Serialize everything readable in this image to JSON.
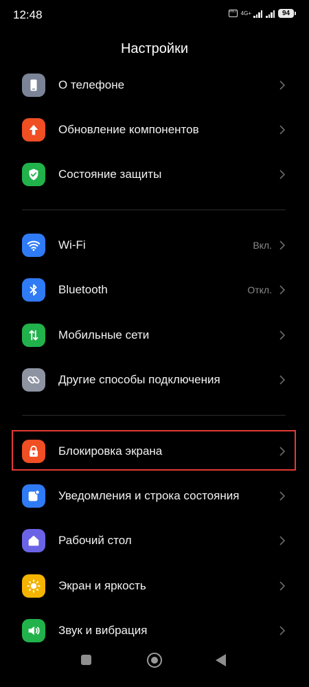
{
  "status_bar": {
    "time": "12:48",
    "volte_label": "VoLTE",
    "network_type": "4G+",
    "battery": "94"
  },
  "header": {
    "title": "Настройки"
  },
  "sections": [
    {
      "items": [
        {
          "label": "О телефоне",
          "value": "",
          "icon": "phone-icon",
          "icon_color": "#7b8497"
        },
        {
          "label": "Обновление компонентов",
          "value": "",
          "icon": "arrow-up-icon",
          "icon_color": "#f04e23"
        },
        {
          "label": "Состояние защиты",
          "value": "",
          "icon": "shield-check-icon",
          "icon_color": "#21b24b"
        }
      ]
    },
    {
      "items": [
        {
          "label": "Wi-Fi",
          "value": "Вкл.",
          "icon": "wifi-icon",
          "icon_color": "#2f7bf6"
        },
        {
          "label": "Bluetooth",
          "value": "Откл.",
          "icon": "bluetooth-icon",
          "icon_color": "#2f7bf6"
        },
        {
          "label": "Мобильные сети",
          "value": "",
          "icon": "mobile-data-icon",
          "icon_color": "#21b24b"
        },
        {
          "label": "Другие способы подключения",
          "value": "",
          "icon": "link-icon",
          "icon_color": "#8d93a1"
        }
      ]
    },
    {
      "items": [
        {
          "label": "Блокировка экрана",
          "value": "",
          "icon": "lock-icon",
          "icon_color": "#f04e23",
          "highlighted": true
        },
        {
          "label": "Уведомления и строка состояния",
          "value": "",
          "icon": "notification-icon",
          "icon_color": "#2f7bf6"
        },
        {
          "label": "Рабочий стол",
          "value": "",
          "icon": "home-icon",
          "icon_color": "#6b63e6"
        },
        {
          "label": "Экран и яркость",
          "value": "",
          "icon": "sun-icon",
          "icon_color": "#f4b400"
        },
        {
          "label": "Звук и вибрация",
          "value": "",
          "icon": "speaker-icon",
          "icon_color": "#21b24b"
        }
      ]
    }
  ],
  "colors": {
    "background": "#000000",
    "highlight_border": "#e53935",
    "divider": "#2c2c2c"
  }
}
